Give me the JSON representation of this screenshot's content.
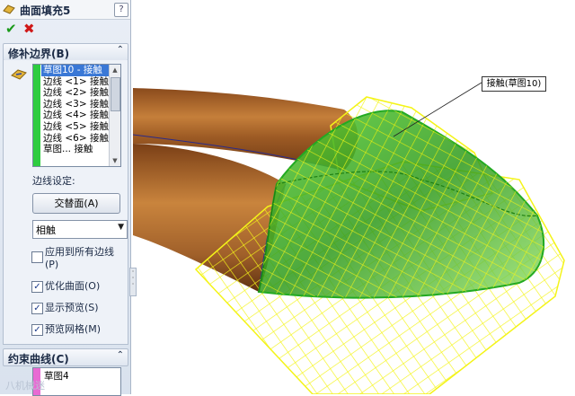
{
  "window": {
    "title": "曲面填充5",
    "help": "?"
  },
  "actions": {
    "ok": "✔",
    "cancel": "✖"
  },
  "patch_boundary": {
    "heading": "修补边界(B)",
    "items": [
      "草图10 - 接触",
      "边线 <1> 接触",
      "边线 <2> 接触",
      "边线 <3> 接触",
      "边线 <4> 接触",
      "边线 <5> 接触",
      "边线 <6> 接触",
      "草图... 接触"
    ],
    "edge_settings_label": "边线设定:",
    "alternate_face_button": "交替面(A)",
    "curvature_select": "相触",
    "apply_all": {
      "label": "应用到所有边线(P)",
      "checked": false
    },
    "optimize": {
      "label": "优化曲面(O)",
      "checked": true
    },
    "show_preview": {
      "label": "显示预览(S)",
      "checked": true
    },
    "preview_mesh": {
      "label": "预览网格(M)",
      "checked": true
    }
  },
  "constraint_curves": {
    "heading": "约束曲线(C)",
    "items": [
      "草图4"
    ]
  },
  "viewport": {
    "callout": "接触(草图10)"
  },
  "watermark": "八机械迷",
  "colors": {
    "accent": "#3a78d6",
    "selection_bar": "#2ecc40",
    "constraint_bar": "#e86ad3",
    "mesh": "#f4f418",
    "surface": "#3fbf1a",
    "wood": "#b06a2a"
  }
}
